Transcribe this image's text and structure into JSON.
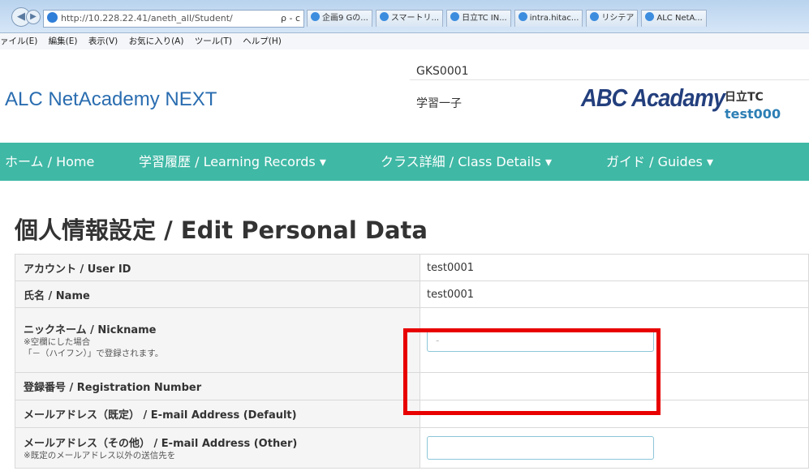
{
  "browser": {
    "address": "http://10.228.22.41/aneth_all/Student/",
    "address_host": "10.228.22.41",
    "address_tools": "ρ - c",
    "tabs": [
      "企画9 Gの...",
      "スマートリ...",
      "日立TC IN...",
      "intra.hitac...",
      "リシテア",
      "ALC NetA..."
    ],
    "menu": [
      "ァイル(E)",
      "編集(E)",
      "表示(V)",
      "お気に入り(A)",
      "ツール(T)",
      "ヘルプ(H)"
    ]
  },
  "header": {
    "brand": "ALC NetAcademy NEXT",
    "code": "GKS0001",
    "user_name": "学習一子",
    "logo": "ABC Acadamy",
    "org": "日立TC",
    "user_id": "test000"
  },
  "nav": {
    "items": [
      "ホーム / Home",
      "学習履歴 / Learning Records ▾",
      "クラス詳細 / Class Details ▾",
      "ガイド / Guides ▾"
    ]
  },
  "page": {
    "title": "個人情報設定 / Edit Personal Data",
    "rows": [
      {
        "label": "アカウント / User ID",
        "value": "test0001"
      },
      {
        "label": "氏名 / Name",
        "value": "test0001"
      },
      {
        "label": "ニックネーム / Nickname",
        "note1": "※空欄にした場合",
        "note2": "「－（ハイフン）」で登録されます。",
        "value": "-"
      },
      {
        "label": "登録番号 / Registration Number",
        "value": ""
      },
      {
        "label": "メールアドレス（既定） / E-mail Address (Default)",
        "value": ""
      },
      {
        "label": "メールアドレス（その他） / E-mail Address (Other)",
        "note1": "※既定のメールアドレス以外の送信先を",
        "value": ""
      }
    ]
  },
  "colors": {
    "nav_bg": "#3fb8a5",
    "brand": "#2a6db0",
    "highlight": "#e80000"
  }
}
